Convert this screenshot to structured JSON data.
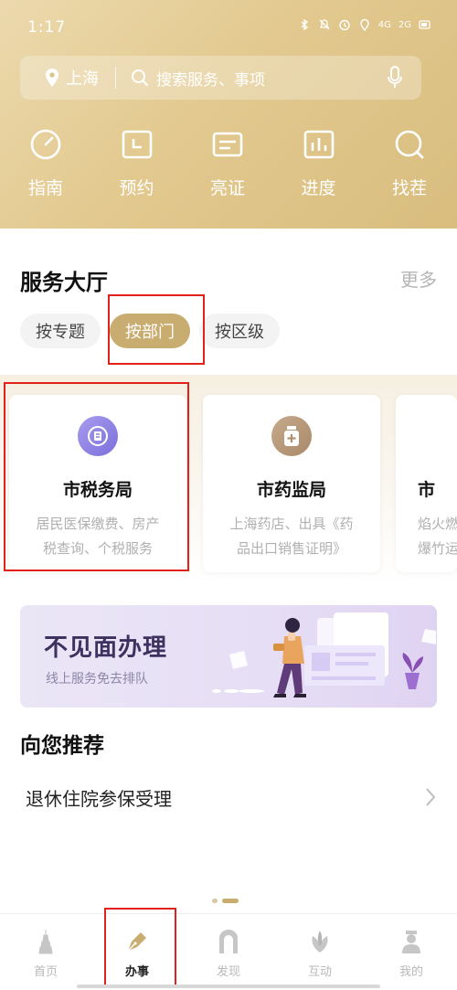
{
  "status_bar": {
    "time": "1:17",
    "signal_4g": "4G",
    "signal_2g": "2G"
  },
  "search": {
    "location": "上海",
    "placeholder": "搜索服务、事项"
  },
  "quick_actions": [
    {
      "label": "指南",
      "icon": "gauge-icon"
    },
    {
      "label": "预约",
      "icon": "calendar-icon"
    },
    {
      "label": "亮证",
      "icon": "id-card-icon"
    },
    {
      "label": "进度",
      "icon": "bar-chart-icon"
    },
    {
      "label": "找茬",
      "icon": "magnifier-icon"
    }
  ],
  "service_hall": {
    "title": "服务大厅",
    "more": "更多",
    "tabs": [
      "按专题",
      "按部门",
      "按区级"
    ],
    "active_tab": "按部门"
  },
  "departments": [
    {
      "name": "市税务局",
      "desc": "居民医保缴费、房产\n税查询、个税服务",
      "icon": "tax-bureau-icon",
      "icon_color": "#8f82e6"
    },
    {
      "name": "市药监局",
      "desc": "上海药店、出具《药\n品出口销售证明》",
      "icon": "medicine-bottle-icon",
      "icon_color": "#b89a7a"
    },
    {
      "name": "市",
      "desc": "焰火燃\n爆竹运",
      "icon": "fire-icon",
      "icon_color": "#d4a15a"
    }
  ],
  "banner": {
    "title": "不见面办理",
    "subtitle": "线上服务免去排队"
  },
  "recommend": {
    "title": "向您推荐",
    "items": [
      {
        "label": "退休住院参保受理"
      }
    ]
  },
  "tab_bar": [
    {
      "label": "首页",
      "icon": "pagoda-icon"
    },
    {
      "label": "办事",
      "icon": "pen-nib-icon"
    },
    {
      "label": "发现",
      "icon": "arch-icon"
    },
    {
      "label": "互动",
      "icon": "magnolia-icon"
    },
    {
      "label": "我的",
      "icon": "person-icon"
    }
  ],
  "active_tab_bar": "办事",
  "colors": {
    "accent": "#c9ad70",
    "highlight_box": "#e2211c",
    "banner_title": "#3d3160"
  }
}
